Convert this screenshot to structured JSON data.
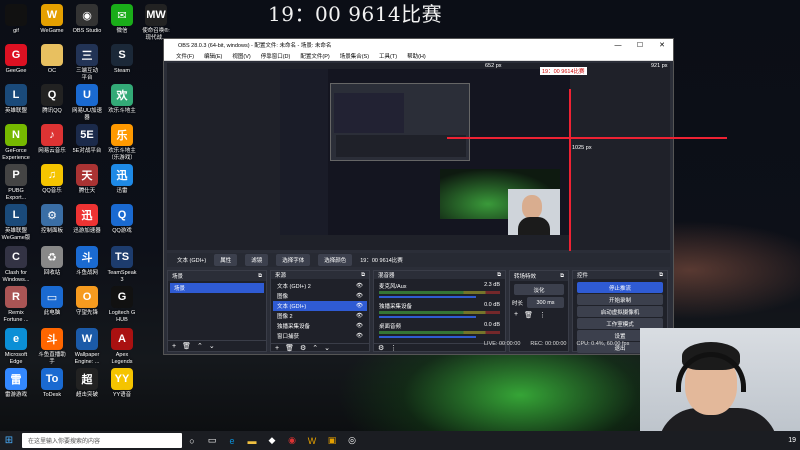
{
  "overlay_title": "19：00 9614比赛",
  "desktop_icons": [
    {
      "label": "gif",
      "color": "#111",
      "glyph": ""
    },
    {
      "label": "WeGame",
      "color": "#e5a000",
      "glyph": "W"
    },
    {
      "label": "OBS Studio",
      "color": "#333",
      "glyph": "◉"
    },
    {
      "label": "微信",
      "color": "#1aad19",
      "glyph": "✉"
    },
    {
      "label": "使命召唤®:\n现代战...",
      "color": "#222",
      "glyph": "MW"
    },
    {
      "label": "GeeGee",
      "color": "#d12",
      "glyph": "G"
    },
    {
      "label": "OC",
      "color": "#e8c060",
      "glyph": ""
    },
    {
      "label": "三端互动\n平台",
      "color": "#235",
      "glyph": "三"
    },
    {
      "label": "Steam",
      "color": "#1b2838",
      "glyph": "S"
    },
    {
      "label": "英雄联盟",
      "color": "#1a4a7a",
      "glyph": "L"
    },
    {
      "label": "腾讯QQ",
      "color": "#222",
      "glyph": "Q"
    },
    {
      "label": "网易UU加速\n器",
      "color": "#1a6ad1",
      "glyph": "U"
    },
    {
      "label": "欢乐斗地主",
      "color": "#3a7",
      "glyph": "欢"
    },
    {
      "label": "GeForce\nExperience",
      "color": "#76b900",
      "glyph": "N"
    },
    {
      "label": "网易云音乐",
      "color": "#d33",
      "glyph": "♪"
    },
    {
      "label": "5E对战平台",
      "color": "#1b2a4a",
      "glyph": "5E"
    },
    {
      "label": "欢乐斗地主\n（乐游戏）",
      "color": "#f90",
      "glyph": "乐"
    },
    {
      "label": "PUBG\nExport...",
      "color": "#444",
      "glyph": "P"
    },
    {
      "label": "QQ音乐",
      "color": "#f5c400",
      "glyph": "♫"
    },
    {
      "label": "腾仕天",
      "color": "#a33",
      "glyph": "天"
    },
    {
      "label": "迅雷",
      "color": "#1e8ae6",
      "glyph": "迅"
    },
    {
      "label": "英雄联盟\nWeGame版",
      "color": "#1a4a7a",
      "glyph": "L"
    },
    {
      "label": "控制面板",
      "color": "#3a6ea5",
      "glyph": "⚙"
    },
    {
      "label": "迅游加速器",
      "color": "#e33",
      "glyph": "迅"
    },
    {
      "label": "QQ游戏",
      "color": "#1a6ad1",
      "glyph": "Q"
    },
    {
      "label": "Clash for\nWindows...",
      "color": "#334",
      "glyph": "C"
    },
    {
      "label": "回收站",
      "color": "#888",
      "glyph": "♻"
    },
    {
      "label": "斗鱼战网",
      "color": "#1a6ad1",
      "glyph": "斗"
    },
    {
      "label": "TeamSpeak\n3",
      "color": "#1d3c6d",
      "glyph": "TS"
    },
    {
      "label": "Remix\nFortune ...",
      "color": "#a55",
      "glyph": "R"
    },
    {
      "label": "此电脑",
      "color": "#1a6ad1",
      "glyph": "▭"
    },
    {
      "label": "守望先锋",
      "color": "#f69b1f",
      "glyph": "O"
    },
    {
      "label": "Logitech G\nHUB",
      "color": "#111",
      "glyph": "G"
    },
    {
      "label": "Microsoft\nEdge",
      "color": "#0b8fd6",
      "glyph": "e"
    },
    {
      "label": "斗鱼直播助\n手",
      "color": "#f60",
      "glyph": "斗"
    },
    {
      "label": "Wallpaper\nEngine: ...",
      "color": "#1b5aa8",
      "glyph": "W"
    },
    {
      "label": "Apex\nLegends",
      "color": "#a11",
      "glyph": "A"
    },
    {
      "label": "雷游游戏",
      "color": "#38f",
      "glyph": "雷"
    },
    {
      "label": "ToDesk",
      "color": "#1a6ad1",
      "glyph": "To"
    },
    {
      "label": "超击突破",
      "color": "#222",
      "glyph": "超"
    },
    {
      "label": "YY语音",
      "color": "#f5c400",
      "glyph": "YY"
    }
  ],
  "obs": {
    "title": "OBS 28.0.3 (64-bit, windows) - 配置文件: 未命名 - 场景: 未命名",
    "menu": [
      "文件(F)",
      "编辑(E)",
      "视图(V)",
      "停靠窗口(D)",
      "配置文件(P)",
      "场景集合(S)",
      "工具(T)",
      "帮助(H)"
    ],
    "preview_labels": {
      "top": "652 px",
      "right": "921 px",
      "mid": "1025 px",
      "overlay": "19：00 9614比赛"
    },
    "source_bar": {
      "name": "文本 (GDI+)",
      "props": "属性",
      "filters": "滤镜",
      "font": "选择字体",
      "color": "选择颜色",
      "text": "19：00 9614比赛"
    },
    "docks": {
      "scenes": {
        "title": "场景",
        "items": [
          "场景"
        ]
      },
      "sources": {
        "title": "来源",
        "items": [
          "文本 (GDI+) 2",
          "图像",
          "文本 (GDI+)",
          "图像 2",
          "独播采集设备",
          "窗口捕获"
        ]
      },
      "mixer": {
        "title": "混音器",
        "channels": [
          {
            "name": "麦克风/Aux",
            "db": "2.3 dB"
          },
          {
            "name": "独播采集设备",
            "db": "0.0 dB"
          },
          {
            "name": "桌面音频",
            "db": "0.0 dB"
          }
        ]
      },
      "transitions": {
        "title": "转场特效",
        "type": "淡化",
        "duration_label": "时长",
        "duration": "300 ms"
      },
      "controls": {
        "title": "控件",
        "buttons": [
          "停止推流",
          "开始录制",
          "启动虚拟摄像机",
          "工作室模式",
          "设置",
          "退出"
        ]
      }
    },
    "status": {
      "live": "LIVE: 00:00:00",
      "rec": "REC: 00:00:00",
      "cpu": "CPU: 0.4%, 60.00 fps"
    }
  },
  "taskbar": {
    "search_placeholder": "在这里输入你要搜索的内容",
    "time": "19"
  }
}
